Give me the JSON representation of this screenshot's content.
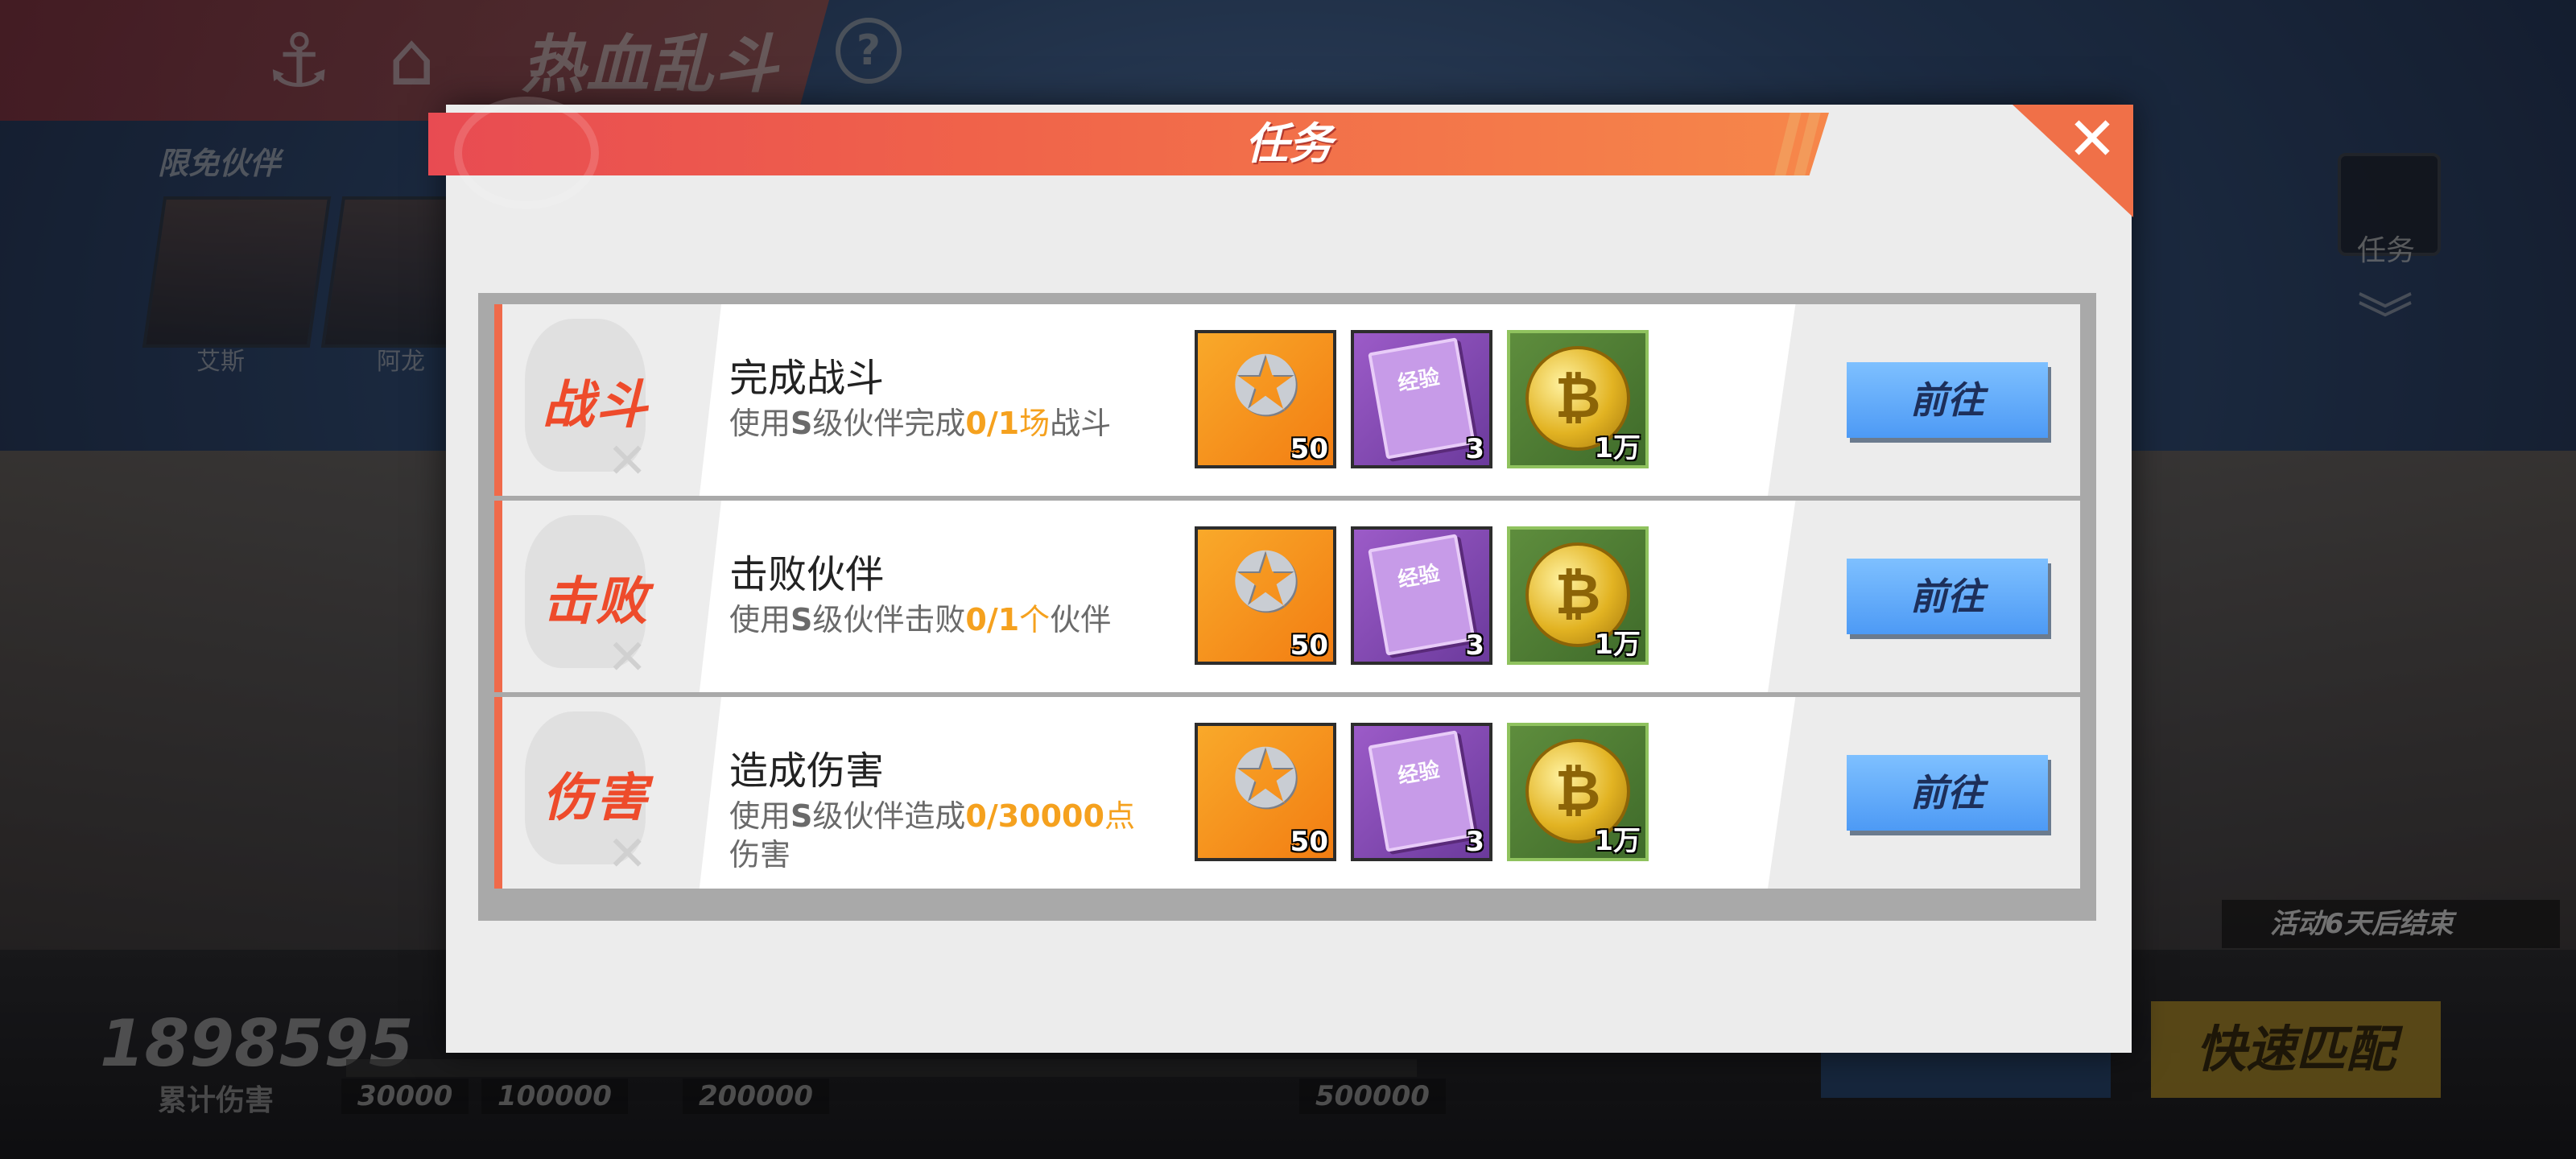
{
  "header": {
    "back_icon": "anchor-back-icon",
    "home_icon": "home-icon",
    "title": "热血乱斗",
    "help_icon": "question-icon",
    "help_glyph": "?"
  },
  "partners": {
    "label": "限免伙伴",
    "items": [
      {
        "name": "艾斯"
      },
      {
        "name": "阿龙"
      }
    ]
  },
  "side": {
    "task_label": "任务",
    "chevron": "︾"
  },
  "activity": {
    "end_text": "活动6天后结束",
    "quick_match": "快速匹配"
  },
  "damage": {
    "total": "1898595",
    "label": "累计伤害",
    "milestones": [
      "30000",
      "100000",
      "200000",
      "500000"
    ]
  },
  "modal": {
    "title": "任务",
    "close_glyph": "✕",
    "tasks": [
      {
        "type": "战斗",
        "title": "完成战斗",
        "desc_prefix": "使用",
        "desc_grade": "S",
        "desc_mid": "级伙伴完成",
        "desc_progress": "0/1",
        "desc_unit": "场",
        "desc_suffix": "战斗",
        "rewards": [
          {
            "icon": "emblem-icon",
            "count": "50"
          },
          {
            "icon": "exp-book-icon",
            "book_text": "经验",
            "count": "3"
          },
          {
            "icon": "gold-coin-icon",
            "count": "1万"
          }
        ],
        "button": "前往"
      },
      {
        "type": "击败",
        "title": "击败伙伴",
        "desc_prefix": "使用",
        "desc_grade": "S",
        "desc_mid": "级伙伴击败",
        "desc_progress": "0/1",
        "desc_unit": "个",
        "desc_suffix": "伙伴",
        "rewards": [
          {
            "icon": "emblem-icon",
            "count": "50"
          },
          {
            "icon": "exp-book-icon",
            "book_text": "经验",
            "count": "3"
          },
          {
            "icon": "gold-coin-icon",
            "count": "1万"
          }
        ],
        "button": "前往"
      },
      {
        "type": "伤害",
        "title": "造成伤害",
        "desc_prefix": "使用",
        "desc_grade": "S",
        "desc_mid": "级伙伴造成",
        "desc_progress": "0/30000",
        "desc_unit": "点",
        "desc_suffix": "伤害",
        "rewards": [
          {
            "icon": "emblem-icon",
            "count": "50"
          },
          {
            "icon": "exp-book-icon",
            "book_text": "经验",
            "count": "3"
          },
          {
            "icon": "gold-coin-icon",
            "count": "1万"
          }
        ],
        "button": "前往"
      }
    ]
  },
  "colors": {
    "accent_red": "#ee4b2b",
    "highlight_orange": "#f5a11e",
    "button_blue": "#5aa6f8"
  }
}
